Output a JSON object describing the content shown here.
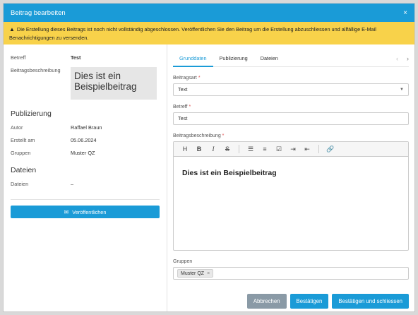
{
  "dialog": {
    "title": "Beitrag bearbeiten",
    "close": "×"
  },
  "warning": {
    "icon": "warning-triangle-icon",
    "text": "Die Erstellung dieses Beitrags ist noch nicht vollständig abgeschlossen. Veröffentlichen Sie den Beitrag um die Erstellung abzuschliessen und allfällige E-Mail Benachrichtigungen zu versenden."
  },
  "summary": {
    "betreff_label": "Betreff",
    "betreff_value": "Test",
    "desc_label": "Beitragsbeschreibung",
    "desc_value": "Dies ist ein Beispielbeitrag"
  },
  "publication": {
    "heading": "Publizierung",
    "author_label": "Autor",
    "author_value": "Raffael Braun",
    "created_label": "Erstellt am",
    "created_value": "05.06.2024",
    "groups_label": "Gruppen",
    "groups_value": "Muster QZ"
  },
  "files": {
    "heading": "Dateien",
    "label": "Dateien",
    "value": "–"
  },
  "publish_button": "Veröffentlichen",
  "tabs": [
    {
      "label": "Grunddaten",
      "active": true
    },
    {
      "label": "Publizierung",
      "active": false
    },
    {
      "label": "Dateien",
      "active": false
    }
  ],
  "tabnav": {
    "prev": "‹",
    "next": "›"
  },
  "form": {
    "type_label": "Beitragsart",
    "type_value": "Text",
    "subject_label": "Betreff",
    "subject_value": "Test",
    "desc_label": "Beitragsbeschreibung",
    "editor_content": "Dies ist ein Beispielbeitrag",
    "groups_label": "Gruppen",
    "group_chip": "Muster QZ",
    "required_mark": "*"
  },
  "toolbar_icons": [
    "heading-icon",
    "bold-icon",
    "italic-icon",
    "strikethrough-icon",
    "bullet-list-icon",
    "numbered-list-icon",
    "checklist-icon",
    "indent-icon",
    "outdent-icon",
    "link-icon"
  ],
  "buttons": {
    "cancel": "Abbrechen",
    "confirm": "Bestätigen",
    "confirm_close": "Bestätigen und schliessen"
  },
  "colors": {
    "accent": "#1a9bd7",
    "warning": "#f8d24a",
    "cancel": "#8a9aa6"
  }
}
